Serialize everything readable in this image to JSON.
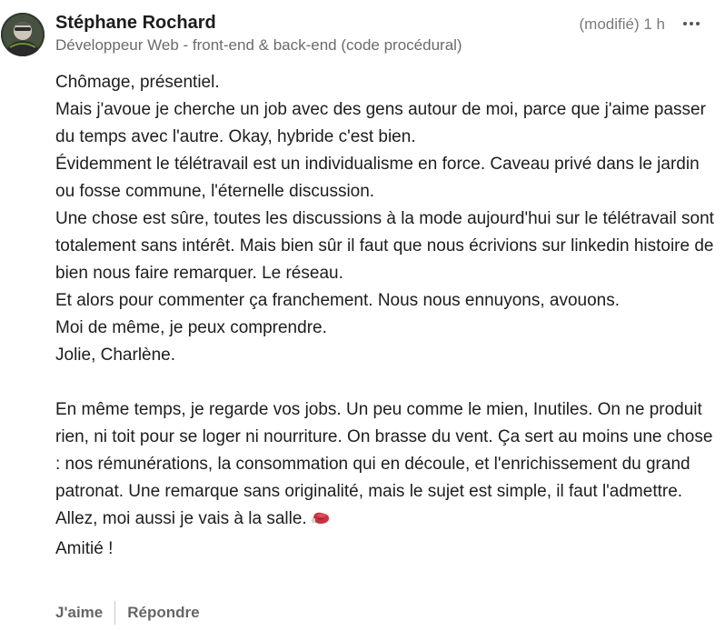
{
  "author": {
    "name": "Stéphane Rochard",
    "headline": "Développeur Web - front-end & back-end (code procédural)",
    "avatar_icon": "profile-photo"
  },
  "meta": {
    "edited_time": "(modifié) 1 h",
    "more_icon": "more-horizontal-icon"
  },
  "comment": {
    "lines": [
      "Chômage, présentiel.",
      "Mais j'avoue je cherche un job avec des gens autour de moi, parce que j'aime passer du temps avec l'autre. Okay, hybride c'est bien.",
      "Évidemment le télétravail est un individualisme en force. Caveau privé dans le jardin ou fosse commune, l'éternelle discussion.",
      "Une chose est sûre, toutes les discussions à la mode aujourd'hui sur le télétravail sont totalement sans intérêt. Mais bien sûr il faut que nous écrivions sur linkedin histoire de bien nous faire remarquer. Le réseau.",
      "Et alors pour commenter ça franchement. Nous nous ennuyons, avouons.",
      "Moi de même, je peux comprendre.",
      "Jolie, Charlène."
    ],
    "paragraph2": "En même temps, je regarde vos jobs. Un peu comme le mien, Inutiles. On ne produit rien, ni toit pour se loger ni nourriture. On brasse du vent. Ça sert au moins une chose : nos rémunérations, la consommation qui en découle, et l'enrichissement du grand patronat. Une remarque sans originalité, mais le sujet est simple, il faut l'admettre. Allez, moi aussi je vais à la salle.",
    "emoji_icon": "boxing-glove-emoji",
    "closing": "Amitié !"
  },
  "actions": {
    "like_label": "J'aime",
    "reply_label": "Répondre"
  }
}
